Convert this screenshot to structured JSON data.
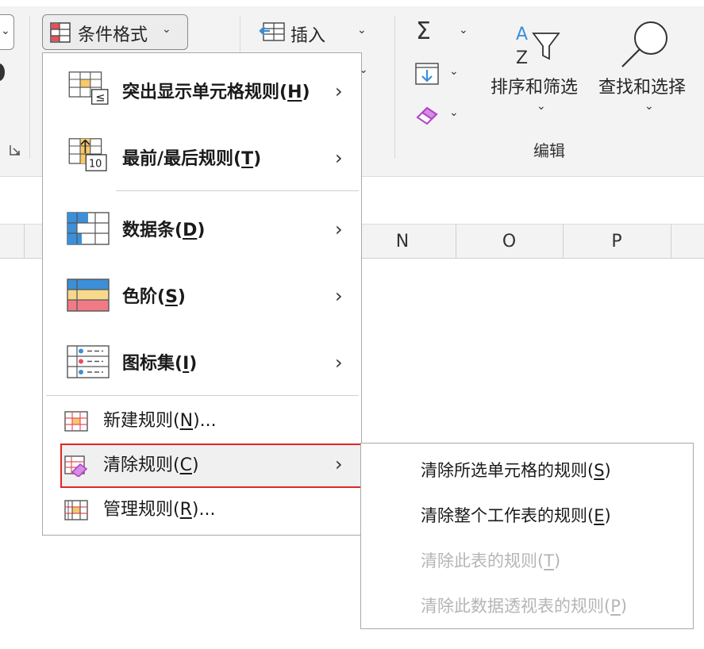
{
  "ribbon": {
    "conditional_format": {
      "label": "条件格式"
    },
    "insert": {
      "label": "插入"
    },
    "sort_filter": {
      "label": "排序和筛选"
    },
    "find_select": {
      "label": "查找和选择"
    },
    "group_editing": {
      "label": "编辑"
    }
  },
  "columns": [
    "N",
    "O",
    "P"
  ],
  "main_menu": {
    "items": [
      {
        "label": "突出显示单元格规则(",
        "key": "H",
        "suffix": ")",
        "icon": "highlight-cells-icon",
        "has_submenu": true
      },
      {
        "label": "最前/最后规则(",
        "key": "T",
        "suffix": ")",
        "icon": "top-bottom-icon",
        "icon_text": "10",
        "has_submenu": true
      },
      {
        "label": "数据条(",
        "key": "D",
        "suffix": ")",
        "icon": "data-bars-icon",
        "has_submenu": true
      },
      {
        "label": "色阶(",
        "key": "S",
        "suffix": ")",
        "icon": "color-scales-icon",
        "has_submenu": true
      },
      {
        "label": "图标集(",
        "key": "I",
        "suffix": ")",
        "icon": "icon-sets-icon",
        "has_submenu": true
      },
      {
        "label": "新建规则(",
        "key": "N",
        "suffix": ")...",
        "icon": "new-rule-icon",
        "has_submenu": false
      },
      {
        "label": "清除规则(",
        "key": "C",
        "suffix": ")",
        "icon": "clear-rules-icon",
        "has_submenu": true
      },
      {
        "label": "管理规则(",
        "key": "R",
        "suffix": ")...",
        "icon": "manage-rules-icon",
        "has_submenu": false
      }
    ]
  },
  "sub_menu": {
    "items": [
      {
        "label": "清除所选单元格的规则(",
        "key": "S",
        "suffix": ")",
        "enabled": true
      },
      {
        "label": "清除整个工作表的规则(",
        "key": "E",
        "suffix": ")",
        "enabled": true
      },
      {
        "label": "清除此表的规则(",
        "key": "T",
        "suffix": ")",
        "enabled": false
      },
      {
        "label": "清除此数据透视表的规则(",
        "key": "P",
        "suffix": ")",
        "enabled": false
      }
    ]
  },
  "colors": {
    "highlight_outline": "#e02626",
    "icon_blue": "#3c8fd8",
    "icon_yellow": "#f6c96b",
    "icon_red": "#e94f5a",
    "icon_purple": "#b044c4",
    "disabled_text": "#b5b5b5"
  }
}
